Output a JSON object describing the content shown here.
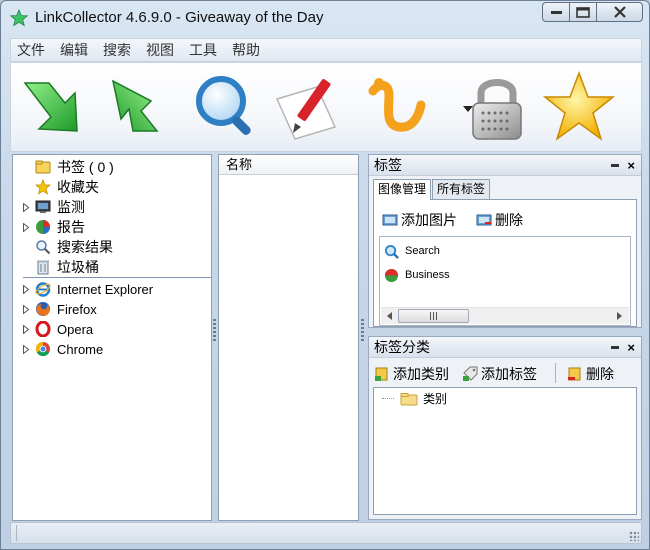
{
  "window": {
    "title": "LinkCollector 4.6.9.0 - Giveaway of the Day",
    "icon": "green-star-icon"
  },
  "menu": [
    "文件",
    "编辑",
    "搜索",
    "视图",
    "工具",
    "帮助"
  ],
  "toolbar": {
    "buttons": [
      {
        "name": "down-arrow-icon"
      },
      {
        "name": "up-arrow-icon"
      },
      {
        "name": "magnifier-icon"
      },
      {
        "name": "paper-pencil-icon"
      },
      {
        "name": "link-tool-icon"
      },
      {
        "name": "padlock-icon"
      },
      {
        "name": "star-icon"
      }
    ]
  },
  "tree": {
    "items": [
      {
        "label": "书签 ( 0 )",
        "icon": "bookmark-folder-icon",
        "expandable": false
      },
      {
        "label": "收藏夹",
        "icon": "star-icon",
        "expandable": false
      },
      {
        "label": "监测",
        "icon": "monitor-icon",
        "expandable": true
      },
      {
        "label": "报告",
        "icon": "pie-chart-icon",
        "expandable": true
      },
      {
        "label": "搜索结果",
        "icon": "search-icon",
        "expandable": false
      },
      {
        "label": "垃圾桶",
        "icon": "trash-icon",
        "expandable": false
      }
    ],
    "browsers": [
      {
        "label": "Internet Explorer",
        "icon": "ie-icon"
      },
      {
        "label": "Firefox",
        "icon": "firefox-icon"
      },
      {
        "label": "Opera",
        "icon": "opera-icon"
      },
      {
        "label": "Chrome",
        "icon": "chrome-icon"
      }
    ]
  },
  "middle": {
    "column_header": "名称"
  },
  "tags_panel": {
    "title": "标签",
    "tabs": [
      "图像管理",
      "所有标签"
    ],
    "actions": {
      "add_image": "添加图片",
      "delete": "删除"
    },
    "list": [
      {
        "label": "Search",
        "icon": "search-icon"
      },
      {
        "label": "Business",
        "icon": "business-icon"
      }
    ]
  },
  "tag_category_panel": {
    "title": "标签分类",
    "actions": {
      "add_category": "添加类别",
      "add_tag": "添加标签",
      "delete": "删除"
    },
    "tree_root": "类别"
  },
  "colors": {
    "accent": "#3c9b2d",
    "panel_bg": "#eef1f6",
    "title_bar": "#d9e6f3"
  }
}
